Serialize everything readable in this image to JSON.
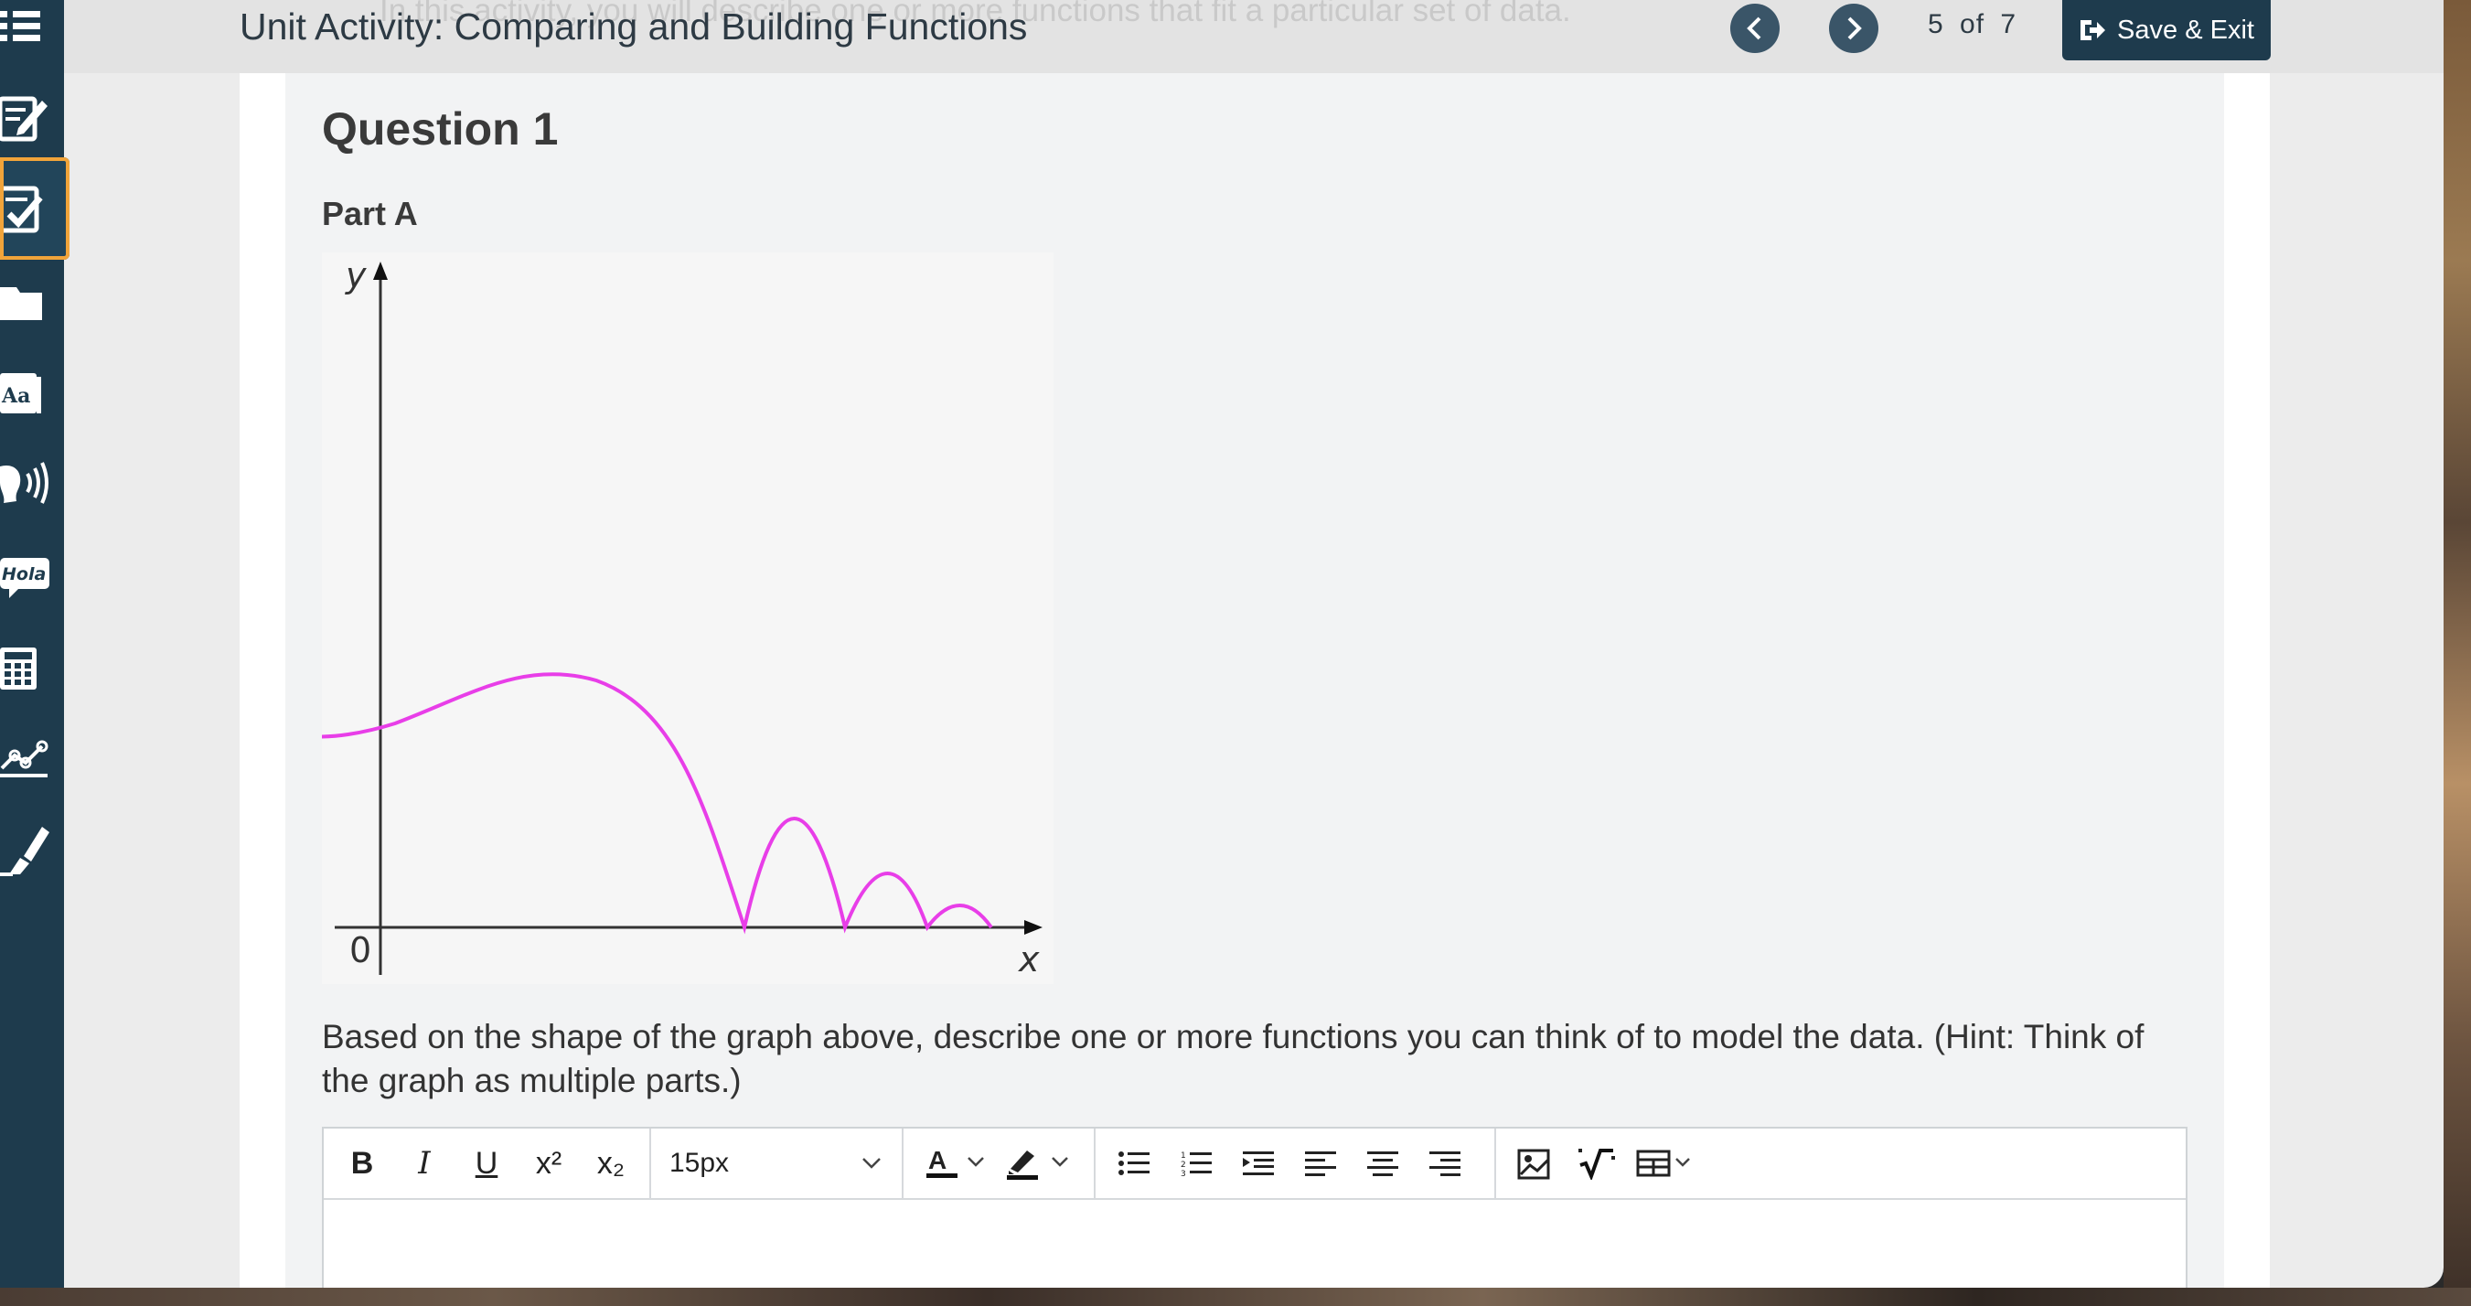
{
  "header": {
    "ghost_text": "In this activity, you will describe one or more functions that fit a particular set of data.",
    "activity_title": "Unit Activity: Comparing and Building Functions",
    "page_current": "5",
    "page_of": "of",
    "page_total": "7",
    "save_exit_label": "Save & Exit"
  },
  "sidebar": {
    "tools": [
      {
        "name": "menu-icon"
      },
      {
        "name": "notepad-icon"
      },
      {
        "name": "checklist-icon",
        "selected": true
      },
      {
        "name": "folder-icon"
      },
      {
        "name": "dictionary-icon",
        "label": "Aa"
      },
      {
        "name": "text-to-speech-icon"
      },
      {
        "name": "translate-icon",
        "label": "Hola"
      },
      {
        "name": "calculator-icon"
      },
      {
        "name": "graph-tool-icon"
      },
      {
        "name": "highlighter-icon"
      }
    ]
  },
  "question": {
    "title": "Question 1",
    "part": "Part A",
    "graph": {
      "y_label": "y",
      "x_label": "x",
      "origin_label": "0",
      "curve_color": "#e83ee8"
    },
    "prompt": "Based on the shape of the graph above, describe one or more functions you can think of to model the data. (Hint: Think of the graph as multiple parts.)"
  },
  "editor": {
    "toolbar": {
      "bold": "B",
      "italic": "I",
      "underline": "U",
      "superscript": "x²",
      "subscript": "x₂",
      "font_size": "15px"
    },
    "content": ""
  },
  "colors": {
    "sidebar": "#1e3b4d",
    "accent_selected": "#f1a43a",
    "button": "#1e3b4d"
  }
}
